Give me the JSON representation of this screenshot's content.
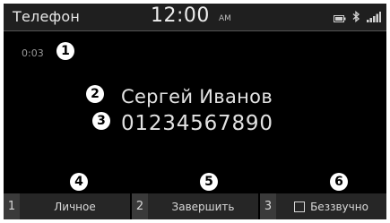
{
  "status_bar": {
    "app_title": "Телефон",
    "time": "12:00",
    "ampm": "AM",
    "icons": [
      "battery-icon",
      "bluetooth-icon",
      "signal-icon"
    ]
  },
  "call": {
    "timer": "0:03",
    "caller_name": "Сергей Иванов",
    "caller_number": "01234567890"
  },
  "callouts": [
    "1",
    "2",
    "3",
    "4",
    "5",
    "6"
  ],
  "softkeys": [
    {
      "number": "1",
      "label": "Личное"
    },
    {
      "number": "2",
      "label": "Завершить"
    },
    {
      "number": "3",
      "label": "Беззвучно"
    }
  ]
}
